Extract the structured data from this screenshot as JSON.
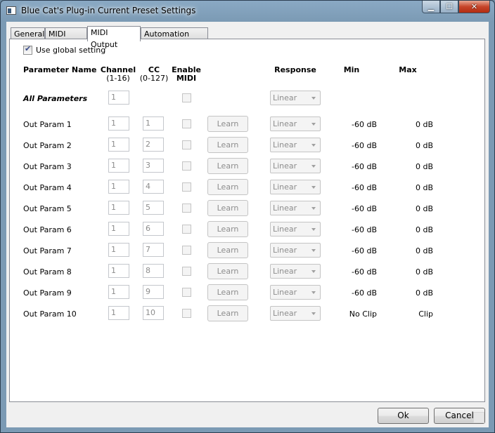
{
  "window": {
    "title": "Blue Cat's Plug-in Current Preset Settings"
  },
  "tabs": [
    {
      "label": "General"
    },
    {
      "label": "MIDI Input"
    },
    {
      "label": "MIDI Output"
    },
    {
      "label": "Automation Output"
    }
  ],
  "global_setting": {
    "label": "Use global setting",
    "checked": true
  },
  "headers": {
    "parameter_name": "Parameter Name",
    "channel": "Channel",
    "channel_range": "(1-16)",
    "cc": "CC",
    "cc_range": "(0-127)",
    "enable_midi_1": "Enable",
    "enable_midi_2": "MIDI",
    "response": "Response",
    "min": "Min",
    "max": "Max"
  },
  "all_parameters": {
    "name": "All Parameters",
    "channel": "1",
    "response": "Linear"
  },
  "learn_label": "Learn",
  "rows": [
    {
      "name": "Out Param 1",
      "channel": "1",
      "cc": "1",
      "response": "Linear",
      "min": "-60 dB",
      "max": "0 dB"
    },
    {
      "name": "Out Param 2",
      "channel": "1",
      "cc": "2",
      "response": "Linear",
      "min": "-60 dB",
      "max": "0 dB"
    },
    {
      "name": "Out Param 3",
      "channel": "1",
      "cc": "3",
      "response": "Linear",
      "min": "-60 dB",
      "max": "0 dB"
    },
    {
      "name": "Out Param 4",
      "channel": "1",
      "cc": "4",
      "response": "Linear",
      "min": "-60 dB",
      "max": "0 dB"
    },
    {
      "name": "Out Param 5",
      "channel": "1",
      "cc": "5",
      "response": "Linear",
      "min": "-60 dB",
      "max": "0 dB"
    },
    {
      "name": "Out Param 6",
      "channel": "1",
      "cc": "6",
      "response": "Linear",
      "min": "-60 dB",
      "max": "0 dB"
    },
    {
      "name": "Out Param 7",
      "channel": "1",
      "cc": "7",
      "response": "Linear",
      "min": "-60 dB",
      "max": "0 dB"
    },
    {
      "name": "Out Param 8",
      "channel": "1",
      "cc": "8",
      "response": "Linear",
      "min": "-60 dB",
      "max": "0 dB"
    },
    {
      "name": "Out Param 9",
      "channel": "1",
      "cc": "9",
      "response": "Linear",
      "min": "-60 dB",
      "max": "0 dB"
    },
    {
      "name": "Out Param 10",
      "channel": "1",
      "cc": "10",
      "response": "Linear",
      "min": "No Clip",
      "max": "Clip"
    }
  ],
  "buttons": {
    "ok": "Ok",
    "cancel": "Cancel"
  }
}
